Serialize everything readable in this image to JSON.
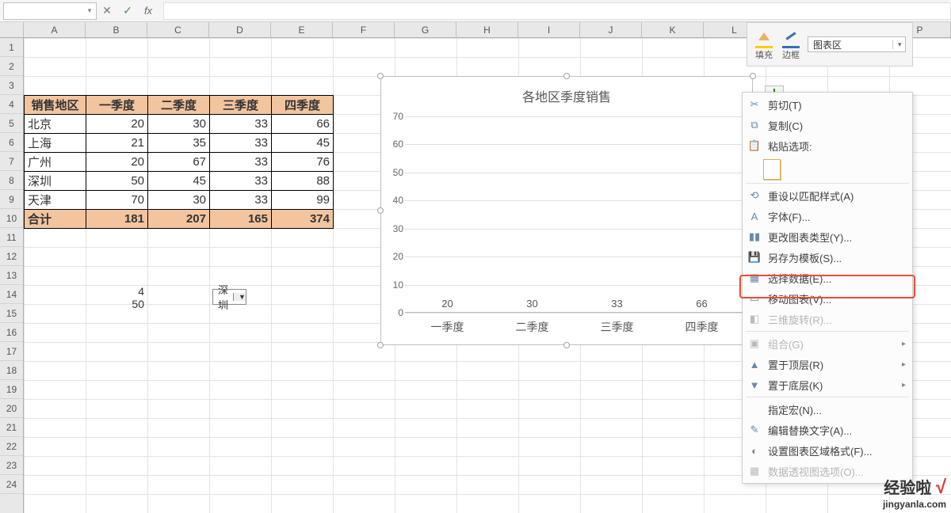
{
  "columns": [
    "A",
    "B",
    "C",
    "D",
    "E",
    "F",
    "G",
    "H",
    "I",
    "J",
    "K",
    "L",
    "",
    "",
    "P"
  ],
  "row_count": 24,
  "table": {
    "headers": [
      "销售地区",
      "一季度",
      "二季度",
      "三季度",
      "四季度"
    ],
    "rows": [
      {
        "region": "北京",
        "q1": 20,
        "q2": 30,
        "q3": 33,
        "q4": 66
      },
      {
        "region": "上海",
        "q1": 21,
        "q2": 35,
        "q3": 33,
        "q4": 45
      },
      {
        "region": "广州",
        "q1": 20,
        "q2": 67,
        "q3": 33,
        "q4": 76
      },
      {
        "region": "深圳",
        "q1": 50,
        "q2": 45,
        "q3": 33,
        "q4": 88
      },
      {
        "region": "天津",
        "q1": 70,
        "q2": 30,
        "q3": 33,
        "q4": 99
      }
    ],
    "total": {
      "label": "合计",
      "q1": 181,
      "q2": 207,
      "q3": 165,
      "q4": 374
    }
  },
  "aux": {
    "val1": "4",
    "val2": "50",
    "combo": "深圳"
  },
  "chart_data": {
    "type": "bar",
    "title": "各地区季度销售",
    "categories": [
      "一季度",
      "二季度",
      "三季度",
      "四季度"
    ],
    "values": [
      20,
      30,
      33,
      66
    ],
    "ylim": [
      0,
      70
    ],
    "ystep": 10,
    "xlabel": "",
    "ylabel": ""
  },
  "fmt_panel": {
    "fill": "填充",
    "border": "边框",
    "area": "图表区"
  },
  "context_menu": {
    "cut": "剪切(T)",
    "copy": "复制(C)",
    "paste_opt": "粘贴选项:",
    "reset": "重设以匹配样式(A)",
    "font": "字体(F)...",
    "change_type": "更改图表类型(Y)...",
    "save_tpl": "另存为模板(S)...",
    "select_data": "选择数据(E)...",
    "move_chart": "移动图表(V)...",
    "rotate3d": "三维旋转(R)...",
    "group": "组合(G)",
    "bring_front": "置于顶层(R)",
    "send_back": "置于底层(K)",
    "assign_macro": "指定宏(N)...",
    "alt_text": "编辑替换文字(A)...",
    "format_area": "设置图表区域格式(F)...",
    "pivot_opt": "数据透视图选项(O)..."
  },
  "watermark": {
    "brand": "经验啦",
    "check": "√",
    "url": "jingyanla.com"
  }
}
